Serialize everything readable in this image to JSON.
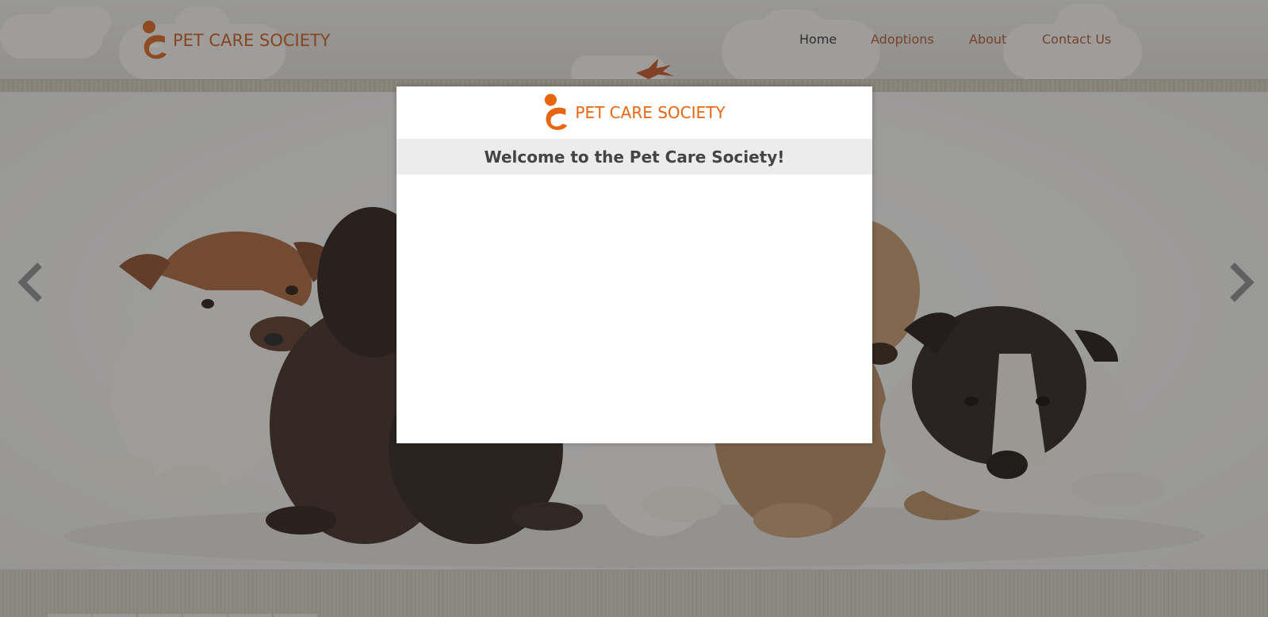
{
  "site": {
    "brand": "PET CARE SOCIETY",
    "accent_color": "#d9641e",
    "nav_color": "#b0542a"
  },
  "nav": {
    "items": [
      {
        "label": "Home",
        "active": true
      },
      {
        "label": "Adoptions",
        "active": false
      },
      {
        "label": "About",
        "active": false
      },
      {
        "label": "Contact Us",
        "active": false
      }
    ]
  },
  "slider": {
    "prev_icon": "chevron-left-icon",
    "next_icon": "chevron-right-icon"
  },
  "modal": {
    "brand": "PET CARE SOCIETY",
    "title": "Welcome to the Pet Care Society!"
  }
}
